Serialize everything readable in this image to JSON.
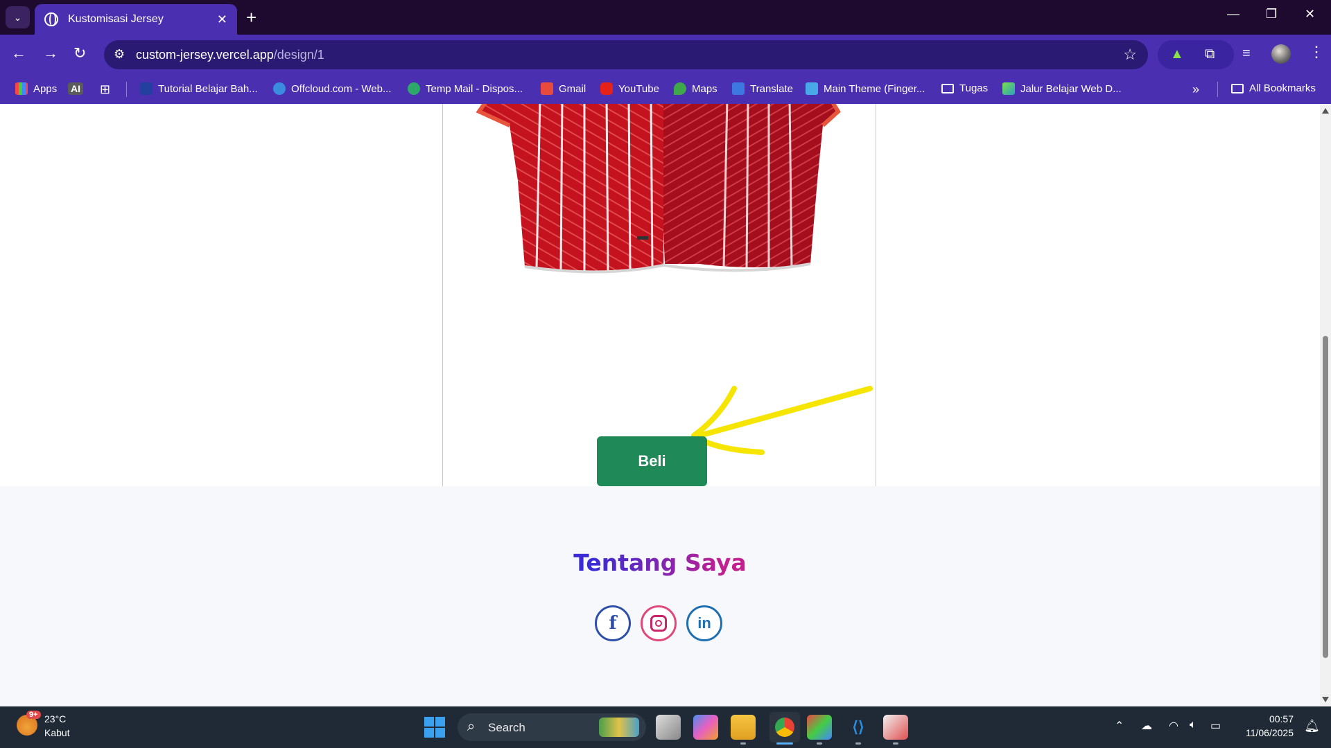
{
  "browser": {
    "tab_title": "Kustomisasi Jersey",
    "url_host": "custom-jersey.vercel.app",
    "url_path": "/design/1",
    "bookmarks": [
      {
        "label": "Apps"
      },
      {
        "label": "Tutorial Belajar Bah..."
      },
      {
        "label": "Offcloud.com - Web..."
      },
      {
        "label": "Temp Mail - Dispos..."
      },
      {
        "label": "Gmail"
      },
      {
        "label": "YouTube"
      },
      {
        "label": "Maps"
      },
      {
        "label": "Translate"
      },
      {
        "label": "Main Theme (Finger..."
      },
      {
        "label": "Tugas"
      },
      {
        "label": "Jalur Belajar Web D..."
      }
    ],
    "ai_badge": "AI",
    "all_bookmarks": "All Bookmarks",
    "overflow": "»"
  },
  "page": {
    "buy_button": "Beli",
    "footer_title": "Tentang Saya",
    "social": {
      "facebook": "f",
      "linkedin": "in"
    }
  },
  "taskbar": {
    "weather_badge": "9+",
    "temperature": "23°C",
    "weather": "Kabut",
    "search_label": "Search",
    "time": "00:57",
    "date": "11/06/2025"
  }
}
